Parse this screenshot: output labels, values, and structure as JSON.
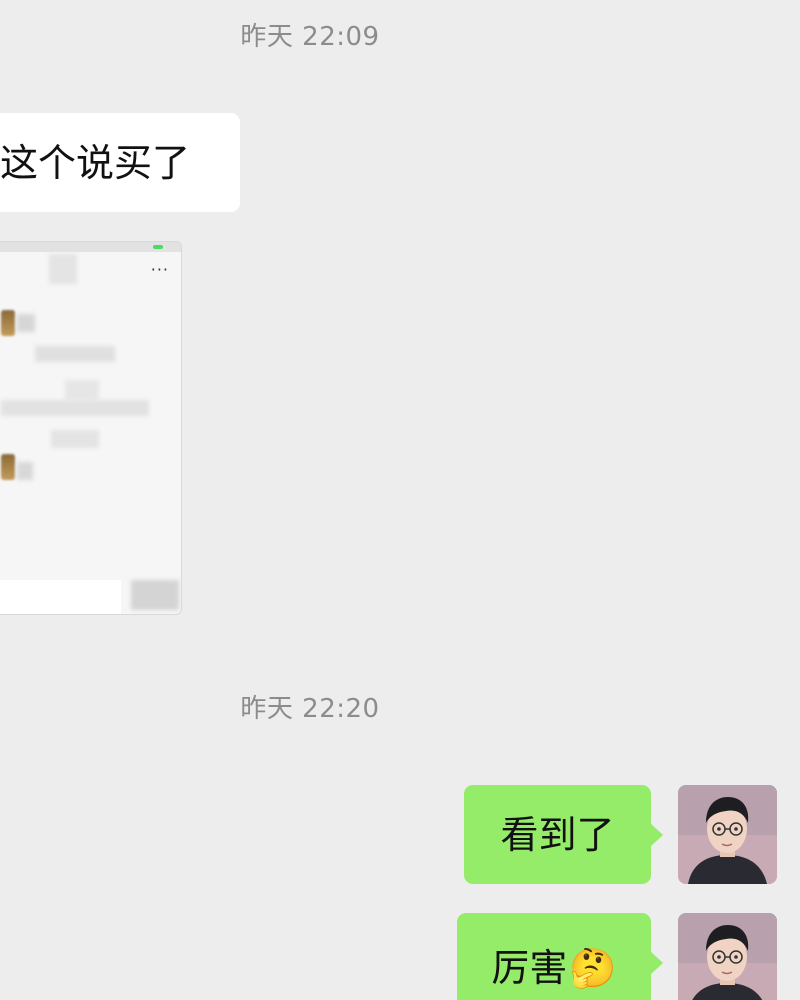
{
  "timestamps": {
    "first": "昨天 22:09",
    "second": "昨天 22:20"
  },
  "messages": {
    "incoming_text": "这个说买了",
    "incoming_image": "blurred-screenshot",
    "outgoing_1": "看到了",
    "outgoing_2": "厉害",
    "outgoing_2_emoji": "🤔"
  },
  "colors": {
    "background": "#ededed",
    "incoming_bubble": "#ffffff",
    "outgoing_bubble": "#95ec69",
    "timestamp_text": "#8c8c8c"
  }
}
